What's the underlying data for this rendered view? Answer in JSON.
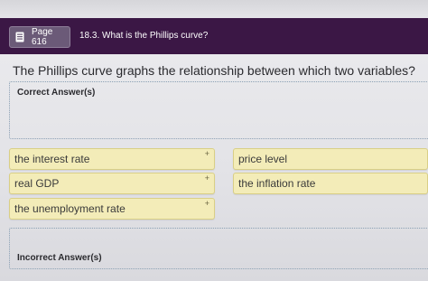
{
  "header": {
    "page_label": "Page 616",
    "section_title": "18.3. What is the Phillips curve?"
  },
  "question": "The Phillips curve graphs the relationship between which two variables?",
  "zones": {
    "correct_label": "Correct Answer(s)",
    "incorrect_label": "Incorrect Answer(s)"
  },
  "chips": [
    {
      "label": "the interest rate"
    },
    {
      "label": "price level"
    },
    {
      "label": "real GDP"
    },
    {
      "label": "the inflation rate"
    },
    {
      "label": "the unemployment rate"
    }
  ],
  "chip_plus": "+",
  "icons": {
    "page": "book-icon"
  },
  "colors": {
    "header_bg": "#3b1745",
    "chip_bg": "#f3ecb8",
    "zone_border": "#8aa0b4"
  }
}
